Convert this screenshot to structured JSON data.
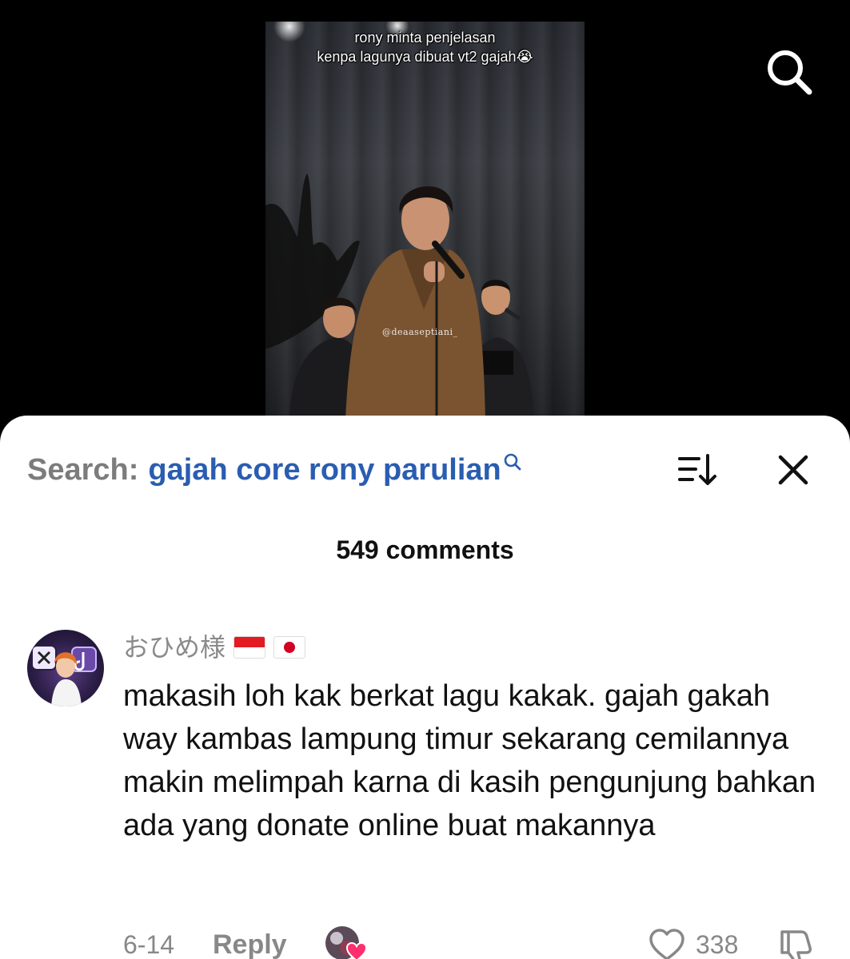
{
  "video": {
    "caption_line1": "rony minta penjelasan",
    "caption_line2": "kenpa lagunya dibuat vt2 gajah😭",
    "watermark": "@deaaseptiani_"
  },
  "search": {
    "prefix": "Search:",
    "query": "gajah core rony parulian"
  },
  "comments_header": {
    "count_label": "549 comments"
  },
  "comment": {
    "username": "おひめ様",
    "text": "makasih loh kak berkat lagu kakak. gajah gakah way kambas lampung timur sekarang cemilannya makin melimpah karna di kasih pengunjung bahkan ada yang donate online buat makannya",
    "date": "6-14",
    "reply_label": "Reply",
    "like_count": "338"
  },
  "colors": {
    "query_blue": "#2a5db0",
    "muted_gray": "#888888",
    "heart_pink": "#ff2e6e"
  },
  "icons": [
    "search-icon",
    "query-search-icon",
    "sort-icon",
    "close-icon",
    "heart-icon",
    "dislike-icon",
    "creator-liked-heart-icon"
  ]
}
